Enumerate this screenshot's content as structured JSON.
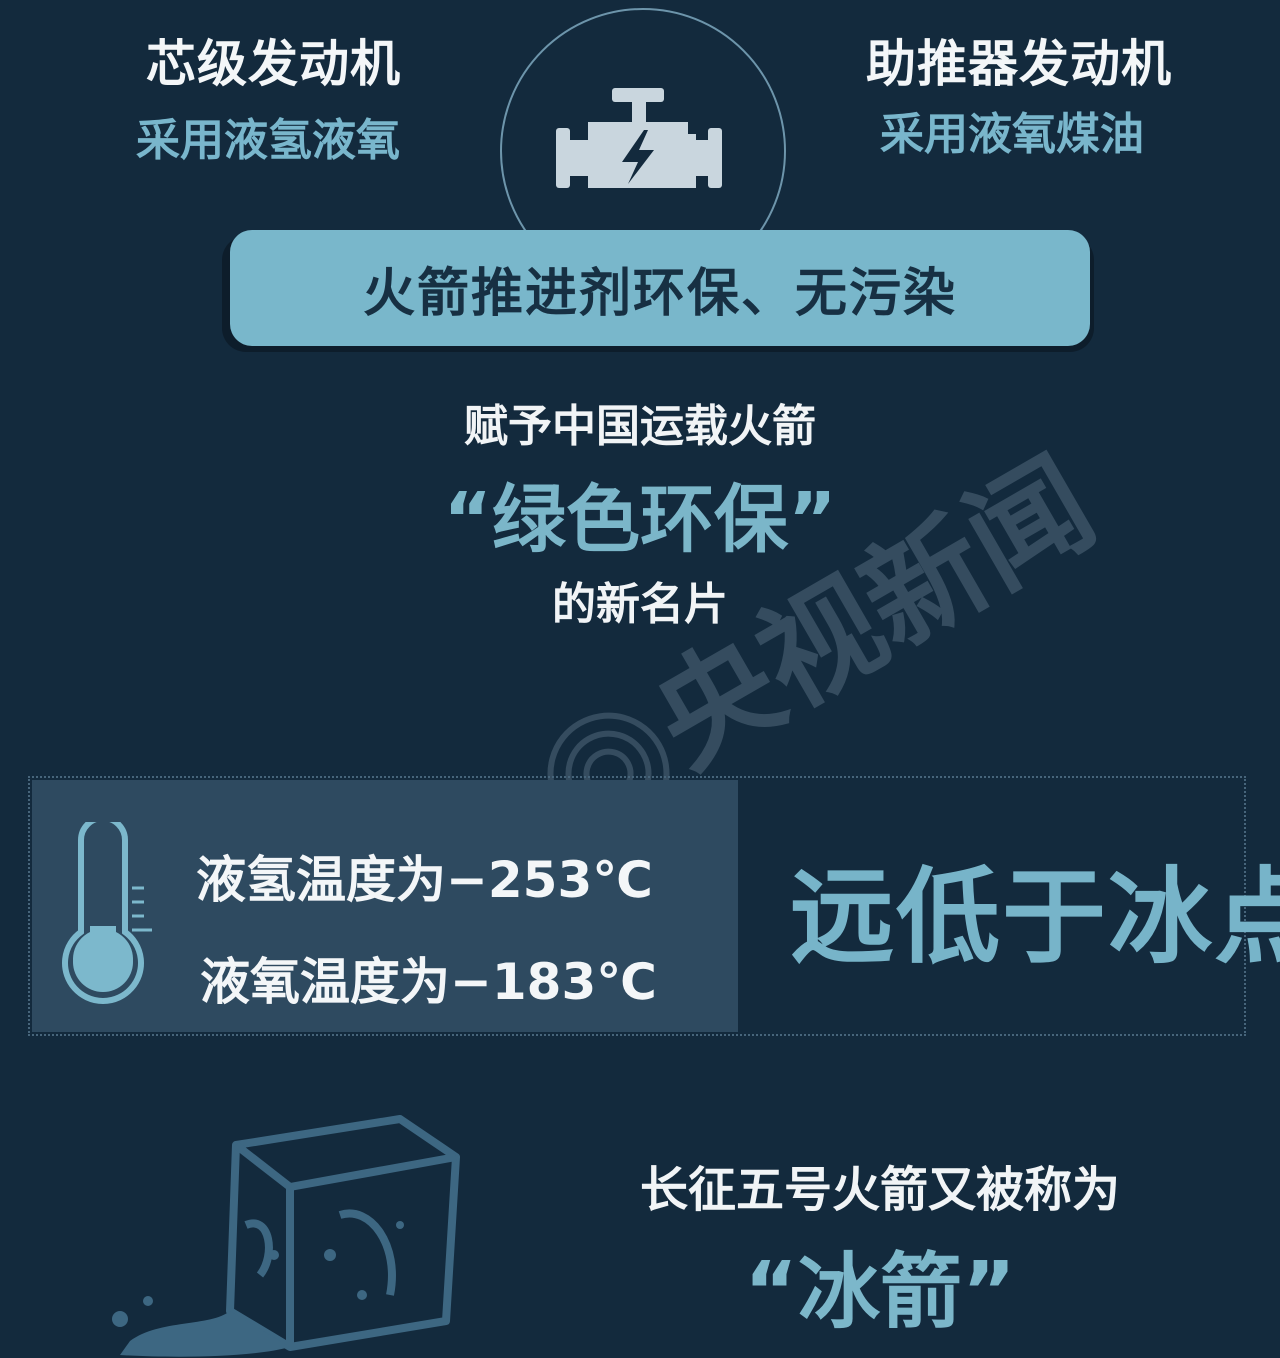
{
  "engines": {
    "core": {
      "title": "芯级发动机",
      "fuel": "采用液氢液氧"
    },
    "booster": {
      "title": "助推器发动机",
      "fuel": "采用液氧煤油"
    },
    "icon": "engine-icon"
  },
  "banner": {
    "text": "火箭推进剂环保、无污染"
  },
  "statement": {
    "line1": "赋予中国运载火箭",
    "highlight": "“绿色环保”",
    "line3": "的新名片"
  },
  "watermark": {
    "text": "央视新闻"
  },
  "temperature": {
    "icon": "thermometer-icon",
    "hydrogen": "液氢温度为−253℃",
    "oxygen": "液氧温度为−183℃",
    "comparison": "远低于冰点"
  },
  "nickname": {
    "icon": "ice-cube-icon",
    "line": "长征五号火箭又被称为",
    "name": "“冰箭”"
  },
  "colors": {
    "background": "#132a3d",
    "accent": "#79b7cb",
    "panel": "#2e4a60",
    "text": "#f1f4f6"
  }
}
